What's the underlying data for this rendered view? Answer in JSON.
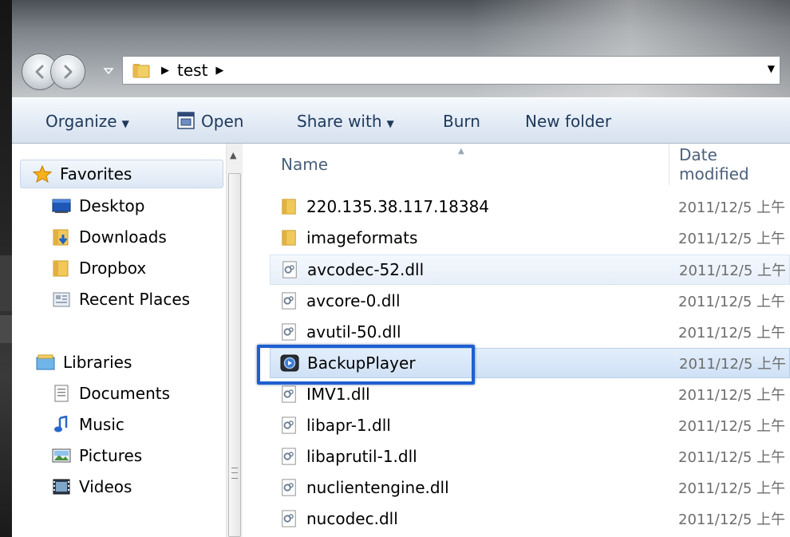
{
  "address": {
    "crumbs": [
      "test"
    ]
  },
  "toolbar": {
    "organize": "Organize",
    "open": "Open",
    "share_with": "Share with",
    "burn": "Burn",
    "new_folder": "New folder"
  },
  "nav": {
    "favorites": "Favorites",
    "favorites_items": [
      "Desktop",
      "Downloads",
      "Dropbox",
      "Recent Places"
    ],
    "libraries": "Libraries",
    "libraries_items": [
      "Documents",
      "Music",
      "Pictures",
      "Videos"
    ]
  },
  "columns": {
    "name": "Name",
    "date": "Date modified"
  },
  "files": [
    {
      "name": "220.135.38.117.18384",
      "type": "folder",
      "date": "2011/12/5 上午"
    },
    {
      "name": "imageformats",
      "type": "folder",
      "date": "2011/12/5 上午"
    },
    {
      "name": "avcodec-52.dll",
      "type": "dll",
      "date": "2011/12/5 上午"
    },
    {
      "name": "avcore-0.dll",
      "type": "dll",
      "date": "2011/12/5 上午"
    },
    {
      "name": "avutil-50.dll",
      "type": "dll",
      "date": "2011/12/5 上午"
    },
    {
      "name": "BackupPlayer",
      "type": "app",
      "date": "2011/12/5 上午"
    },
    {
      "name": "IMV1.dll",
      "type": "dll",
      "date": "2011/12/5 上午"
    },
    {
      "name": "libapr-1.dll",
      "type": "dll",
      "date": "2011/12/5 上午"
    },
    {
      "name": "libaprutil-1.dll",
      "type": "dll",
      "date": "2011/12/5 上午"
    },
    {
      "name": "nuclientengine.dll",
      "type": "dll",
      "date": "2011/12/5 上午"
    },
    {
      "name": "nucodec.dll",
      "type": "dll",
      "date": "2011/12/5 上午"
    }
  ],
  "colors": {
    "highlight": "#1f5fd1",
    "command_text": "#1e395b"
  }
}
